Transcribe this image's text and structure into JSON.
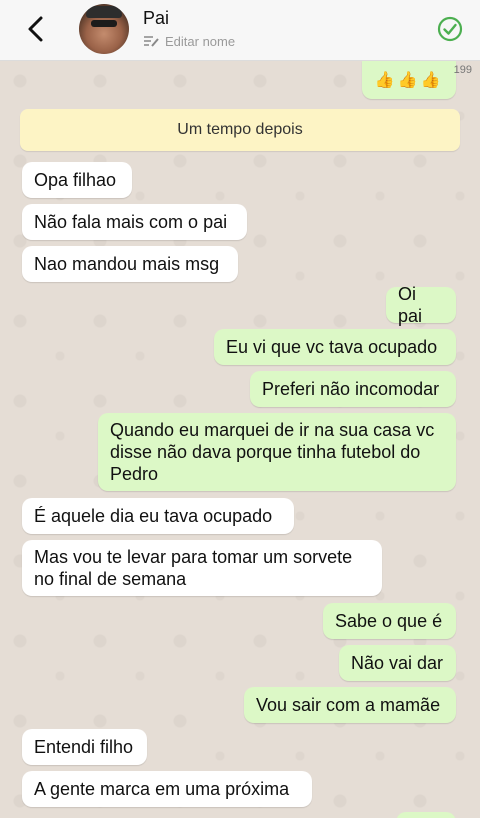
{
  "header": {
    "name": "Pai",
    "edit_label": "Editar nome"
  },
  "count_label": "199",
  "top_emojis": "👍👍👍",
  "notice": "Um tempo depois",
  "messages": [
    {
      "dir": "in",
      "text": "Opa filhao"
    },
    {
      "dir": "in",
      "text": "Não fala mais com o pai"
    },
    {
      "dir": "in",
      "text": "Nao mandou mais msg"
    },
    {
      "dir": "out",
      "text": "Oi pai"
    },
    {
      "dir": "out",
      "text": "Eu vi que vc tava ocupado"
    },
    {
      "dir": "out",
      "text": "Preferi não incomodar"
    },
    {
      "dir": "out",
      "text": "Quando eu marquei de ir na sua casa vc disse não dava porque tinha futebol do Pedro"
    },
    {
      "dir": "in",
      "text": "É aquele dia eu tava ocupado"
    },
    {
      "dir": "in",
      "text": "Mas vou te levar para tomar um sorvete no final de semana"
    },
    {
      "dir": "out",
      "text": "Sabe o que é"
    },
    {
      "dir": "out",
      "text": "Não vai dar"
    },
    {
      "dir": "out",
      "text": "Vou sair com a mamãe"
    },
    {
      "dir": "in",
      "text": "Entendi filho"
    },
    {
      "dir": "in",
      "text": "A gente marca em uma próxima"
    }
  ],
  "colors": {
    "incoming": "#ffffff",
    "outgoing": "#dcf8c6",
    "notice": "#fdf4c5",
    "accent": "#4caf50"
  }
}
